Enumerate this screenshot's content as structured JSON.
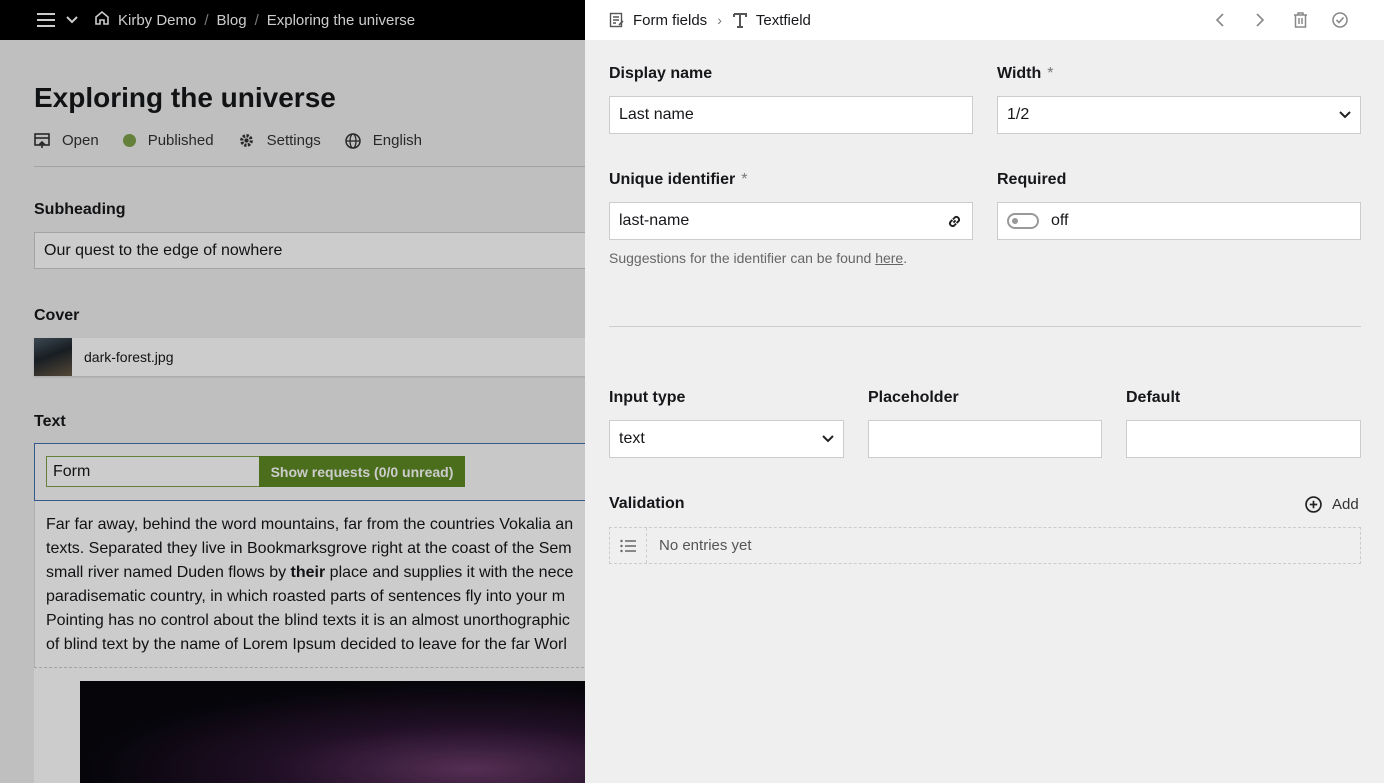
{
  "topbar": {
    "breadcrumb": [
      "Kirby Demo",
      "Blog",
      "Exploring the universe"
    ],
    "separator": "/"
  },
  "page": {
    "title": "Exploring the universe",
    "actions": {
      "open": "Open",
      "status": "Published",
      "settings": "Settings",
      "language": "English"
    },
    "status_color": "#7fa04a"
  },
  "fields": {
    "subheading": {
      "label": "Subheading",
      "value": "Our quest to the edge of nowhere"
    },
    "cover": {
      "label": "Cover",
      "filename": "dark-forest.jpg"
    },
    "text": {
      "label": "Text",
      "form_input_value": "Form",
      "requests_button": "Show requests (0/0 unread)",
      "lines": [
        "Far far away, behind the word mountains, far from the countries Vokalia an",
        "texts. Separated they live in Bookmarksgrove right at the coast of the Sem",
        "small river named Duden flows by ",
        "their",
        " place and supplies it with the nece",
        "paradisematic country, in which roasted parts of sentences fly into your m",
        "Pointing has no control about the blind texts it is an almost unorthographic",
        "of blind text by the name of Lorem Ipsum decided to leave for the far Worl"
      ]
    }
  },
  "drawer": {
    "breadcrumb": {
      "parent": "Form fields",
      "separator": "›",
      "current": "Textfield"
    },
    "icons": [
      "chevron-left-icon",
      "chevron-right-icon",
      "trash-icon",
      "check-circle-icon"
    ],
    "display_name": {
      "label": "Display name",
      "value": "Last name"
    },
    "width": {
      "label": "Width",
      "required_mark": "*",
      "value": "1/2"
    },
    "identifier": {
      "label": "Unique identifier",
      "required_mark": "*",
      "value": "last-name",
      "help_prefix": "Suggestions for the identifier can be found ",
      "help_link": "here",
      "help_suffix": "."
    },
    "required": {
      "label": "Required",
      "value": "off"
    },
    "input_type": {
      "label": "Input type",
      "value": "text"
    },
    "placeholder": {
      "label": "Placeholder",
      "value": ""
    },
    "default": {
      "label": "Default",
      "value": ""
    },
    "validation": {
      "label": "Validation",
      "add_label": "Add",
      "empty_text": "No entries yet"
    }
  },
  "colors": {
    "topbar_bg": "#000000",
    "accent_green": "#5d8a22",
    "focus_blue": "#4271ae"
  }
}
